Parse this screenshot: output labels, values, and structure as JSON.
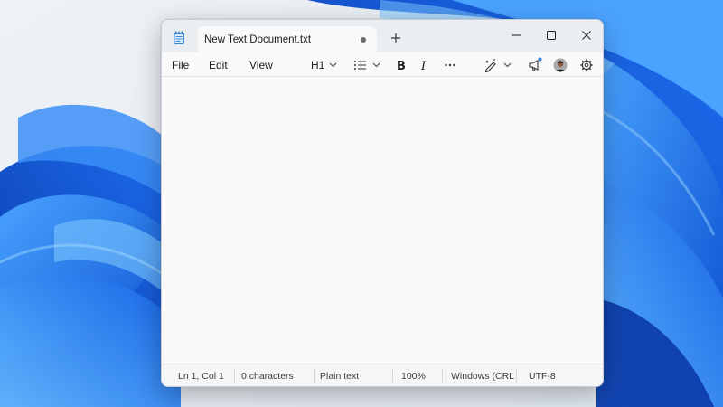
{
  "window": {
    "tab_title": "New Text Document.txt"
  },
  "menu": {
    "file": "File",
    "edit": "Edit",
    "view": "View"
  },
  "toolbar": {
    "heading": "H1"
  },
  "editor": {
    "content": ""
  },
  "status": {
    "position": "Ln 1, Col 1",
    "characters": "0 characters",
    "format": "Plain text",
    "zoom": "100%",
    "line_ending": "Windows (CRLF)",
    "encoding": "UTF-8"
  },
  "colors": {
    "wallpaper_blue": "#1f6fe0",
    "window_bg": "#f9f9f9",
    "titlebar_bg": "#eaeef2"
  }
}
